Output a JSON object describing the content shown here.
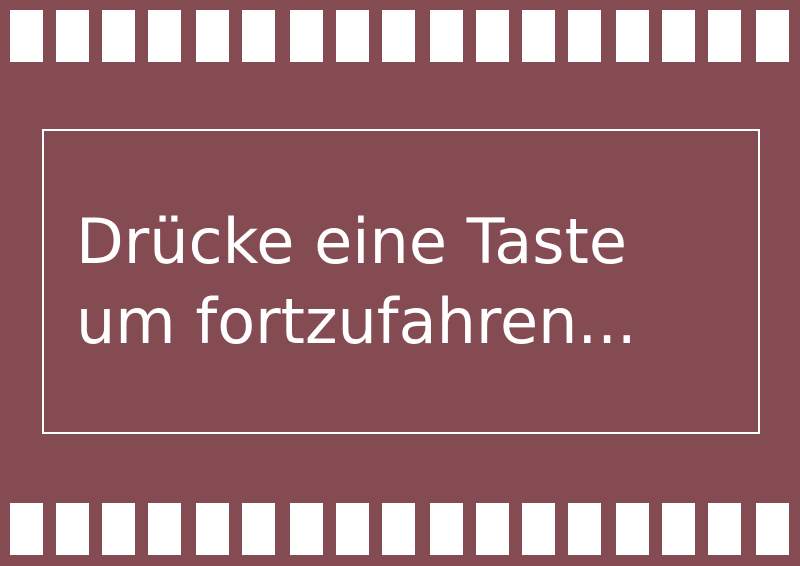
{
  "colors": {
    "background": "#854b53",
    "foreground": "#ffffff"
  },
  "prompt": {
    "line1": "Drücke eine Taste",
    "line2": "um fortzufahren..."
  }
}
